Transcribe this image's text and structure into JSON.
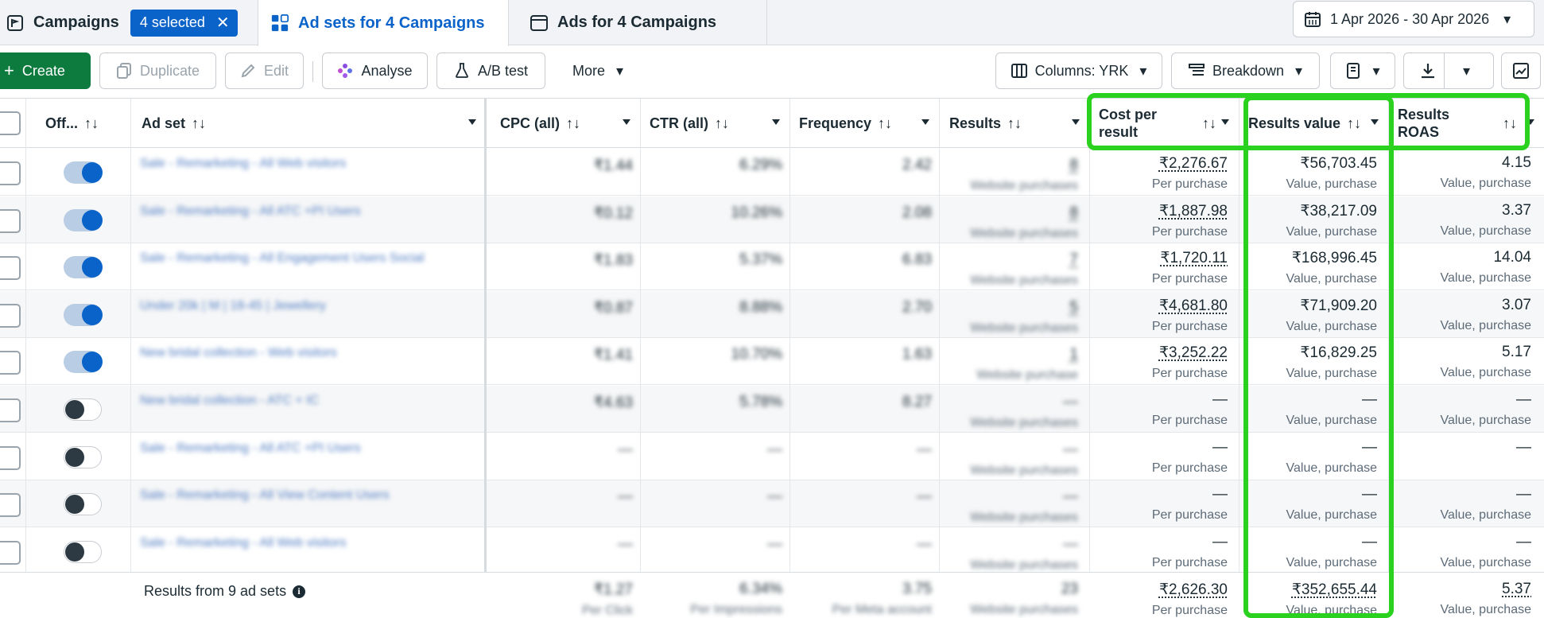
{
  "tabs": {
    "campaigns": "Campaigns",
    "selected_badge": "4 selected",
    "adsets": "Ad sets for 4 Campaigns",
    "ads": "Ads for 4 Campaigns"
  },
  "date_range": "1 Apr 2026 - 30 Apr 2026",
  "toolbar": {
    "create": "Create",
    "duplicate": "Duplicate",
    "edit": "Edit",
    "analyse": "Analyse",
    "ab_test": "A/B test",
    "more": "More",
    "columns": "Columns: YRK",
    "breakdown": "Breakdown"
  },
  "columns": {
    "off": "Off...",
    "ad_set": "Ad set",
    "cpc": "CPC (all)",
    "ctr": "CTR (all)",
    "frequency": "Frequency",
    "results": "Results",
    "cost_per_result_1": "Cost per",
    "cost_per_result_2": "result",
    "results_value": "Results value",
    "results_roas_1": "Results",
    "results_roas_2": "ROAS"
  },
  "rows": [
    {
      "on": true,
      "name": "Sale - Remarketing - All Web visitors",
      "cpc": "₹1.44",
      "ctr": "6.29%",
      "freq": "2.42",
      "results": "8",
      "results_sub": "Website purchases",
      "cost": "₹2,276.67",
      "cost_sub": "Per purchase",
      "value": "₹56,703.45",
      "value_sub": "Value, purchase",
      "roas": "4.15",
      "roas_sub": "Value, purchase"
    },
    {
      "on": true,
      "name": "Sale - Remarketing - All ATC +PI Users",
      "cpc": "₹0.12",
      "ctr": "10.26%",
      "freq": "2.08",
      "results": "8",
      "results_sub": "Website purchases",
      "cost": "₹1,887.98",
      "cost_sub": "Per purchase",
      "value": "₹38,217.09",
      "value_sub": "Value, purchase",
      "roas": "3.37",
      "roas_sub": "Value, purchase"
    },
    {
      "on": true,
      "name": "Sale - Remarketing - All Engagement Users Social",
      "cpc": "₹1.83",
      "ctr": "5.37%",
      "freq": "6.83",
      "results": "7",
      "results_sub": "Website purchases",
      "cost": "₹1,720.11",
      "cost_sub": "Per purchase",
      "value": "₹168,996.45",
      "value_sub": "Value, purchase",
      "roas": "14.04",
      "roas_sub": "Value, purchase"
    },
    {
      "on": true,
      "name": "Under 20k | M | 18-45 | Jewellery",
      "cpc": "₹0.87",
      "ctr": "8.88%",
      "freq": "2.70",
      "results": "5",
      "results_sub": "Website purchases",
      "cost": "₹4,681.80",
      "cost_sub": "Per purchase",
      "value": "₹71,909.20",
      "value_sub": "Value, purchase",
      "roas": "3.07",
      "roas_sub": "Value, purchase"
    },
    {
      "on": true,
      "name": "New bridal collection - Web visitors",
      "cpc": "₹1.41",
      "ctr": "10.70%",
      "freq": "1.63",
      "results": "1",
      "results_sub": "Website purchase",
      "cost": "₹3,252.22",
      "cost_sub": "Per purchase",
      "value": "₹16,829.25",
      "value_sub": "Value, purchase",
      "roas": "5.17",
      "roas_sub": "Value, purchase"
    },
    {
      "on": false,
      "name": "New bridal collection - ATC + IC",
      "cpc": "₹4.63",
      "ctr": "5.78%",
      "freq": "8.27",
      "results": "—",
      "results_sub": "Website purchases",
      "cost": "—",
      "cost_sub": "Per purchase",
      "value": "—",
      "value_sub": "Value, purchase",
      "roas": "—",
      "roas_sub": "Value, purchase"
    },
    {
      "on": false,
      "name": "Sale - Remarketing - All ATC +PI Users",
      "cpc": "—",
      "ctr": "—",
      "freq": "—",
      "results": "—",
      "results_sub": "Website purchases",
      "cost": "—",
      "cost_sub": "Per purchase",
      "value": "—",
      "value_sub": "Value, purchase",
      "roas": "—",
      "roas_sub": ""
    },
    {
      "on": false,
      "name": "Sale - Remarketing - All View Content Users",
      "cpc": "—",
      "ctr": "—",
      "freq": "—",
      "results": "—",
      "results_sub": "Website purchases",
      "cost": "—",
      "cost_sub": "Per purchase",
      "value": "—",
      "value_sub": "Value, purchase",
      "roas": "—",
      "roas_sub": "Value, purchase"
    },
    {
      "on": false,
      "name": "Sale - Remarketing - All Web visitors",
      "cpc": "—",
      "ctr": "—",
      "freq": "—",
      "results": "—",
      "results_sub": "Website purchases",
      "cost": "—",
      "cost_sub": "Per purchase",
      "value": "—",
      "value_sub": "Value, purchase",
      "roas": "—",
      "roas_sub": "Value, purchase"
    }
  ],
  "footer": {
    "label": "Results from 9 ad sets",
    "cpc": "₹1.27",
    "cpc_sub": "Per Click",
    "ctr": "6.34%",
    "ctr_sub": "Per Impressions",
    "freq": "3.75",
    "freq_sub": "Per Meta account",
    "results": "23",
    "results_sub": "Website purchases",
    "cost": "₹2,626.30",
    "cost_sub": "Per purchase",
    "value": "₹352,655.44",
    "value_sub": "Value, purchase",
    "roas": "5.37",
    "roas_sub": "Value, purchase"
  },
  "colors": {
    "accent": "#0a63c9",
    "create": "#0d7a3e",
    "highlight": "#2ad11f"
  }
}
